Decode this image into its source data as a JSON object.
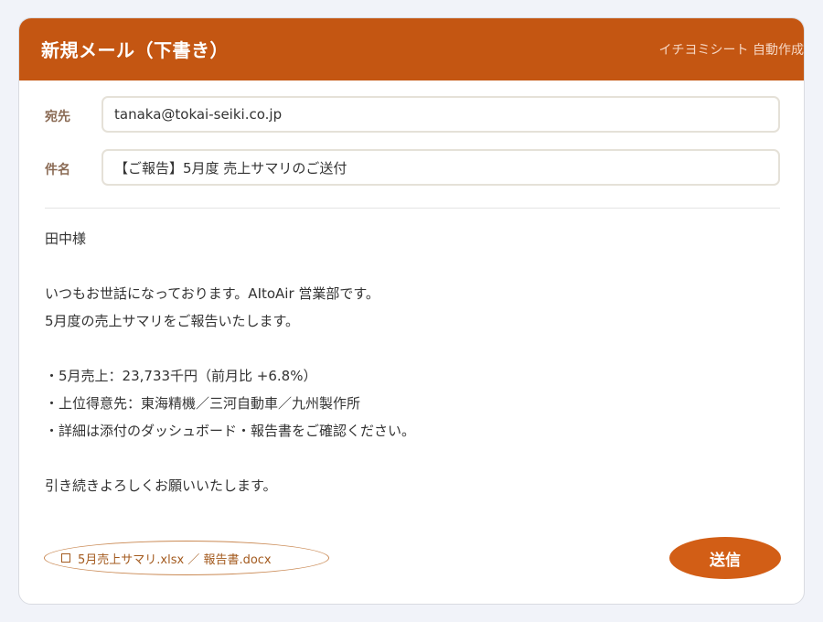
{
  "header": {
    "title": "新規メール（下書き）",
    "subtitle": "イチヨミシート 自動作成"
  },
  "fields": {
    "to_label": "宛先",
    "to_value": "tanaka@tokai-seiki.co.jp",
    "subject_label": "件名",
    "subject_value": "【ご報告】5月度 売上サマリのご送付"
  },
  "body": {
    "lines": [
      "田中様",
      "",
      "いつもお世話になっております。AItoAir 営業部です。",
      "5月度の売上サマリをご報告いたします。",
      "",
      "・5月売上：23,733千円（前月比 +6.8%）",
      "・上位得意先：東海精機／三河自動車／九州製作所",
      "・詳細は添付のダッシュボード・報告書をご確認ください。",
      "",
      "引き続きよろしくお願いいたします。"
    ]
  },
  "attachments": {
    "text": "5月売上サマリ.xlsx ／ 報告書.docx",
    "icon": "attachment-box-icon"
  },
  "actions": {
    "send_label": "送信"
  },
  "colors": {
    "header_bg": "#c45612",
    "send_button": "#d25e16",
    "attachment_outline": "#c98852"
  }
}
